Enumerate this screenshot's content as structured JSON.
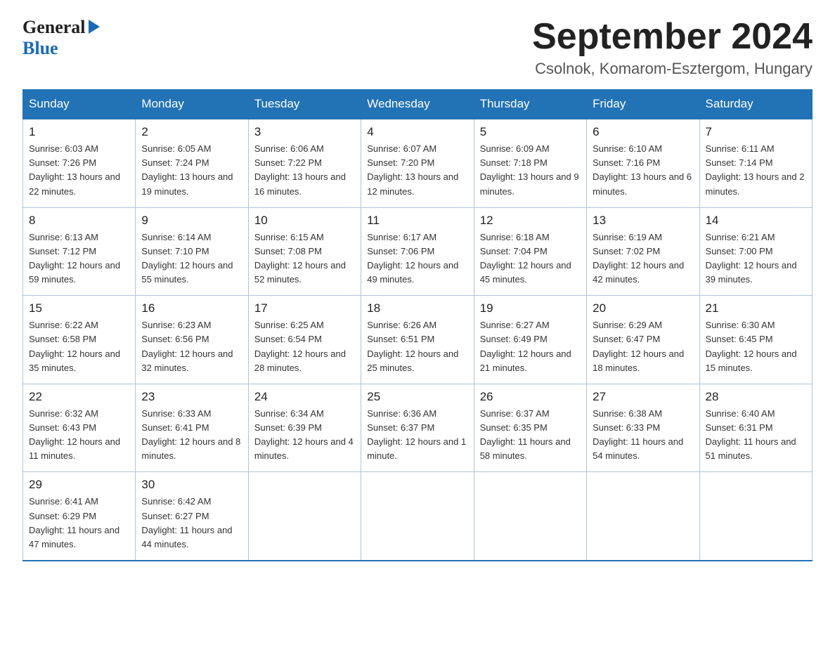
{
  "header": {
    "logo_top": "General",
    "logo_arrow": "▶",
    "logo_bottom": "Blue",
    "month_title": "September 2024",
    "location": "Csolnok, Komarom-Esztergom, Hungary"
  },
  "calendar": {
    "days_of_week": [
      "Sunday",
      "Monday",
      "Tuesday",
      "Wednesday",
      "Thursday",
      "Friday",
      "Saturday"
    ],
    "weeks": [
      [
        {
          "day": "1",
          "sunrise": "6:03 AM",
          "sunset": "7:26 PM",
          "daylight": "13 hours and 22 minutes."
        },
        {
          "day": "2",
          "sunrise": "6:05 AM",
          "sunset": "7:24 PM",
          "daylight": "13 hours and 19 minutes."
        },
        {
          "day": "3",
          "sunrise": "6:06 AM",
          "sunset": "7:22 PM",
          "daylight": "13 hours and 16 minutes."
        },
        {
          "day": "4",
          "sunrise": "6:07 AM",
          "sunset": "7:20 PM",
          "daylight": "13 hours and 12 minutes."
        },
        {
          "day": "5",
          "sunrise": "6:09 AM",
          "sunset": "7:18 PM",
          "daylight": "13 hours and 9 minutes."
        },
        {
          "day": "6",
          "sunrise": "6:10 AM",
          "sunset": "7:16 PM",
          "daylight": "13 hours and 6 minutes."
        },
        {
          "day": "7",
          "sunrise": "6:11 AM",
          "sunset": "7:14 PM",
          "daylight": "13 hours and 2 minutes."
        }
      ],
      [
        {
          "day": "8",
          "sunrise": "6:13 AM",
          "sunset": "7:12 PM",
          "daylight": "12 hours and 59 minutes."
        },
        {
          "day": "9",
          "sunrise": "6:14 AM",
          "sunset": "7:10 PM",
          "daylight": "12 hours and 55 minutes."
        },
        {
          "day": "10",
          "sunrise": "6:15 AM",
          "sunset": "7:08 PM",
          "daylight": "12 hours and 52 minutes."
        },
        {
          "day": "11",
          "sunrise": "6:17 AM",
          "sunset": "7:06 PM",
          "daylight": "12 hours and 49 minutes."
        },
        {
          "day": "12",
          "sunrise": "6:18 AM",
          "sunset": "7:04 PM",
          "daylight": "12 hours and 45 minutes."
        },
        {
          "day": "13",
          "sunrise": "6:19 AM",
          "sunset": "7:02 PM",
          "daylight": "12 hours and 42 minutes."
        },
        {
          "day": "14",
          "sunrise": "6:21 AM",
          "sunset": "7:00 PM",
          "daylight": "12 hours and 39 minutes."
        }
      ],
      [
        {
          "day": "15",
          "sunrise": "6:22 AM",
          "sunset": "6:58 PM",
          "daylight": "12 hours and 35 minutes."
        },
        {
          "day": "16",
          "sunrise": "6:23 AM",
          "sunset": "6:56 PM",
          "daylight": "12 hours and 32 minutes."
        },
        {
          "day": "17",
          "sunrise": "6:25 AM",
          "sunset": "6:54 PM",
          "daylight": "12 hours and 28 minutes."
        },
        {
          "day": "18",
          "sunrise": "6:26 AM",
          "sunset": "6:51 PM",
          "daylight": "12 hours and 25 minutes."
        },
        {
          "day": "19",
          "sunrise": "6:27 AM",
          "sunset": "6:49 PM",
          "daylight": "12 hours and 21 minutes."
        },
        {
          "day": "20",
          "sunrise": "6:29 AM",
          "sunset": "6:47 PM",
          "daylight": "12 hours and 18 minutes."
        },
        {
          "day": "21",
          "sunrise": "6:30 AM",
          "sunset": "6:45 PM",
          "daylight": "12 hours and 15 minutes."
        }
      ],
      [
        {
          "day": "22",
          "sunrise": "6:32 AM",
          "sunset": "6:43 PM",
          "daylight": "12 hours and 11 minutes."
        },
        {
          "day": "23",
          "sunrise": "6:33 AM",
          "sunset": "6:41 PM",
          "daylight": "12 hours and 8 minutes."
        },
        {
          "day": "24",
          "sunrise": "6:34 AM",
          "sunset": "6:39 PM",
          "daylight": "12 hours and 4 minutes."
        },
        {
          "day": "25",
          "sunrise": "6:36 AM",
          "sunset": "6:37 PM",
          "daylight": "12 hours and 1 minute."
        },
        {
          "day": "26",
          "sunrise": "6:37 AM",
          "sunset": "6:35 PM",
          "daylight": "11 hours and 58 minutes."
        },
        {
          "day": "27",
          "sunrise": "6:38 AM",
          "sunset": "6:33 PM",
          "daylight": "11 hours and 54 minutes."
        },
        {
          "day": "28",
          "sunrise": "6:40 AM",
          "sunset": "6:31 PM",
          "daylight": "11 hours and 51 minutes."
        }
      ],
      [
        {
          "day": "29",
          "sunrise": "6:41 AM",
          "sunset": "6:29 PM",
          "daylight": "11 hours and 47 minutes."
        },
        {
          "day": "30",
          "sunrise": "6:42 AM",
          "sunset": "6:27 PM",
          "daylight": "11 hours and 44 minutes."
        },
        null,
        null,
        null,
        null,
        null
      ]
    ]
  }
}
